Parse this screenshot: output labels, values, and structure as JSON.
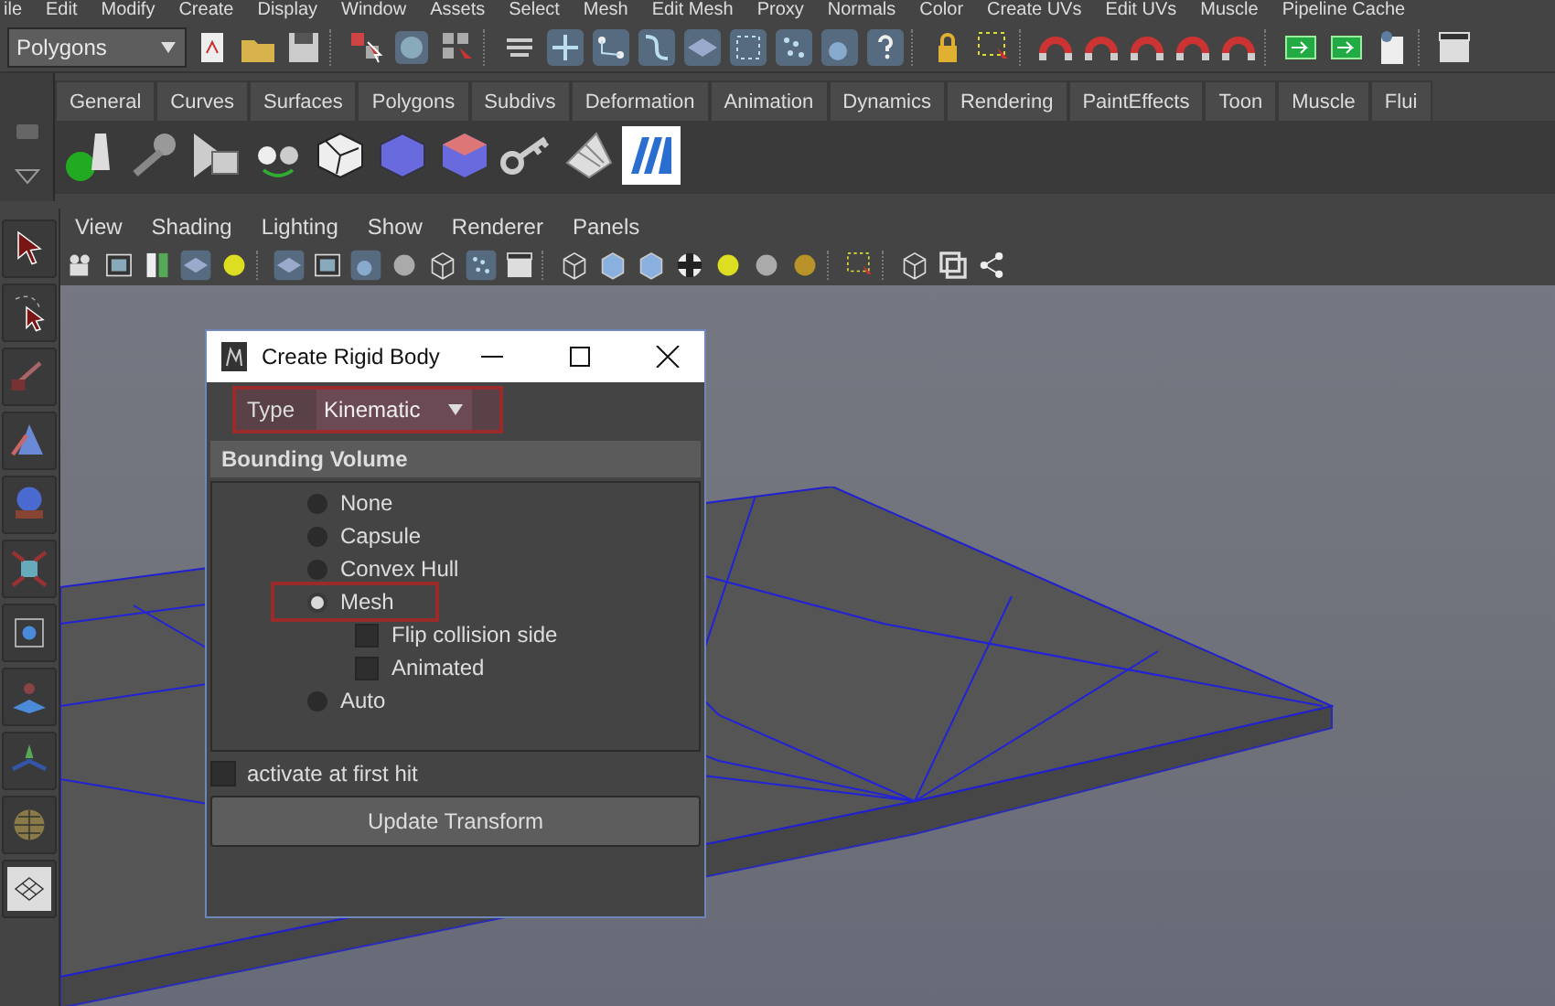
{
  "menu_bar": [
    "ile",
    "Edit",
    "Modify",
    "Create",
    "Display",
    "Window",
    "Assets",
    "Select",
    "Mesh",
    "Edit Mesh",
    "Proxy",
    "Normals",
    "Color",
    "Create UVs",
    "Edit UVs",
    "Muscle",
    "Pipeline Cache"
  ],
  "status_line": {
    "mode": "Polygons"
  },
  "shelf": {
    "tabs": [
      {
        "label": "General",
        "selected": false
      },
      {
        "label": "Curves",
        "selected": false
      },
      {
        "label": "Surfaces",
        "selected": false
      },
      {
        "label": "Polygons",
        "selected": false
      },
      {
        "label": "Subdivs",
        "selected": false
      },
      {
        "label": "Deformation",
        "selected": false
      },
      {
        "label": "Animation",
        "selected": false
      },
      {
        "label": "Dynamics",
        "selected": false
      },
      {
        "label": "Rendering",
        "selected": false
      },
      {
        "label": "PaintEffects",
        "selected": false
      },
      {
        "label": "Toon",
        "selected": false
      },
      {
        "label": "Muscle",
        "selected": false
      },
      {
        "label": "Flui",
        "selected": false
      }
    ]
  },
  "panel_menu": [
    "View",
    "Shading",
    "Lighting",
    "Show",
    "Renderer",
    "Panels"
  ],
  "dialog": {
    "title": "Create Rigid Body",
    "type": {
      "label": "Type",
      "value": "Kinematic",
      "highlighted": true
    },
    "section": "Bounding Volume",
    "options": [
      {
        "kind": "radio",
        "label": "None",
        "selected": false,
        "highlighted": false
      },
      {
        "kind": "radio",
        "label": "Capsule",
        "selected": false,
        "highlighted": false
      },
      {
        "kind": "radio",
        "label": "Convex Hull",
        "selected": false,
        "highlighted": false
      },
      {
        "kind": "radio",
        "label": "Mesh",
        "selected": true,
        "highlighted": true,
        "children": [
          {
            "kind": "checkbox",
            "label": "Flip collision side",
            "checked": false
          },
          {
            "kind": "checkbox",
            "label": "Animated",
            "checked": false
          }
        ]
      },
      {
        "kind": "radio",
        "label": "Auto",
        "selected": false,
        "highlighted": false
      }
    ],
    "activate": {
      "label": "activate at first hit",
      "checked": false
    },
    "button": "Update Transform"
  }
}
